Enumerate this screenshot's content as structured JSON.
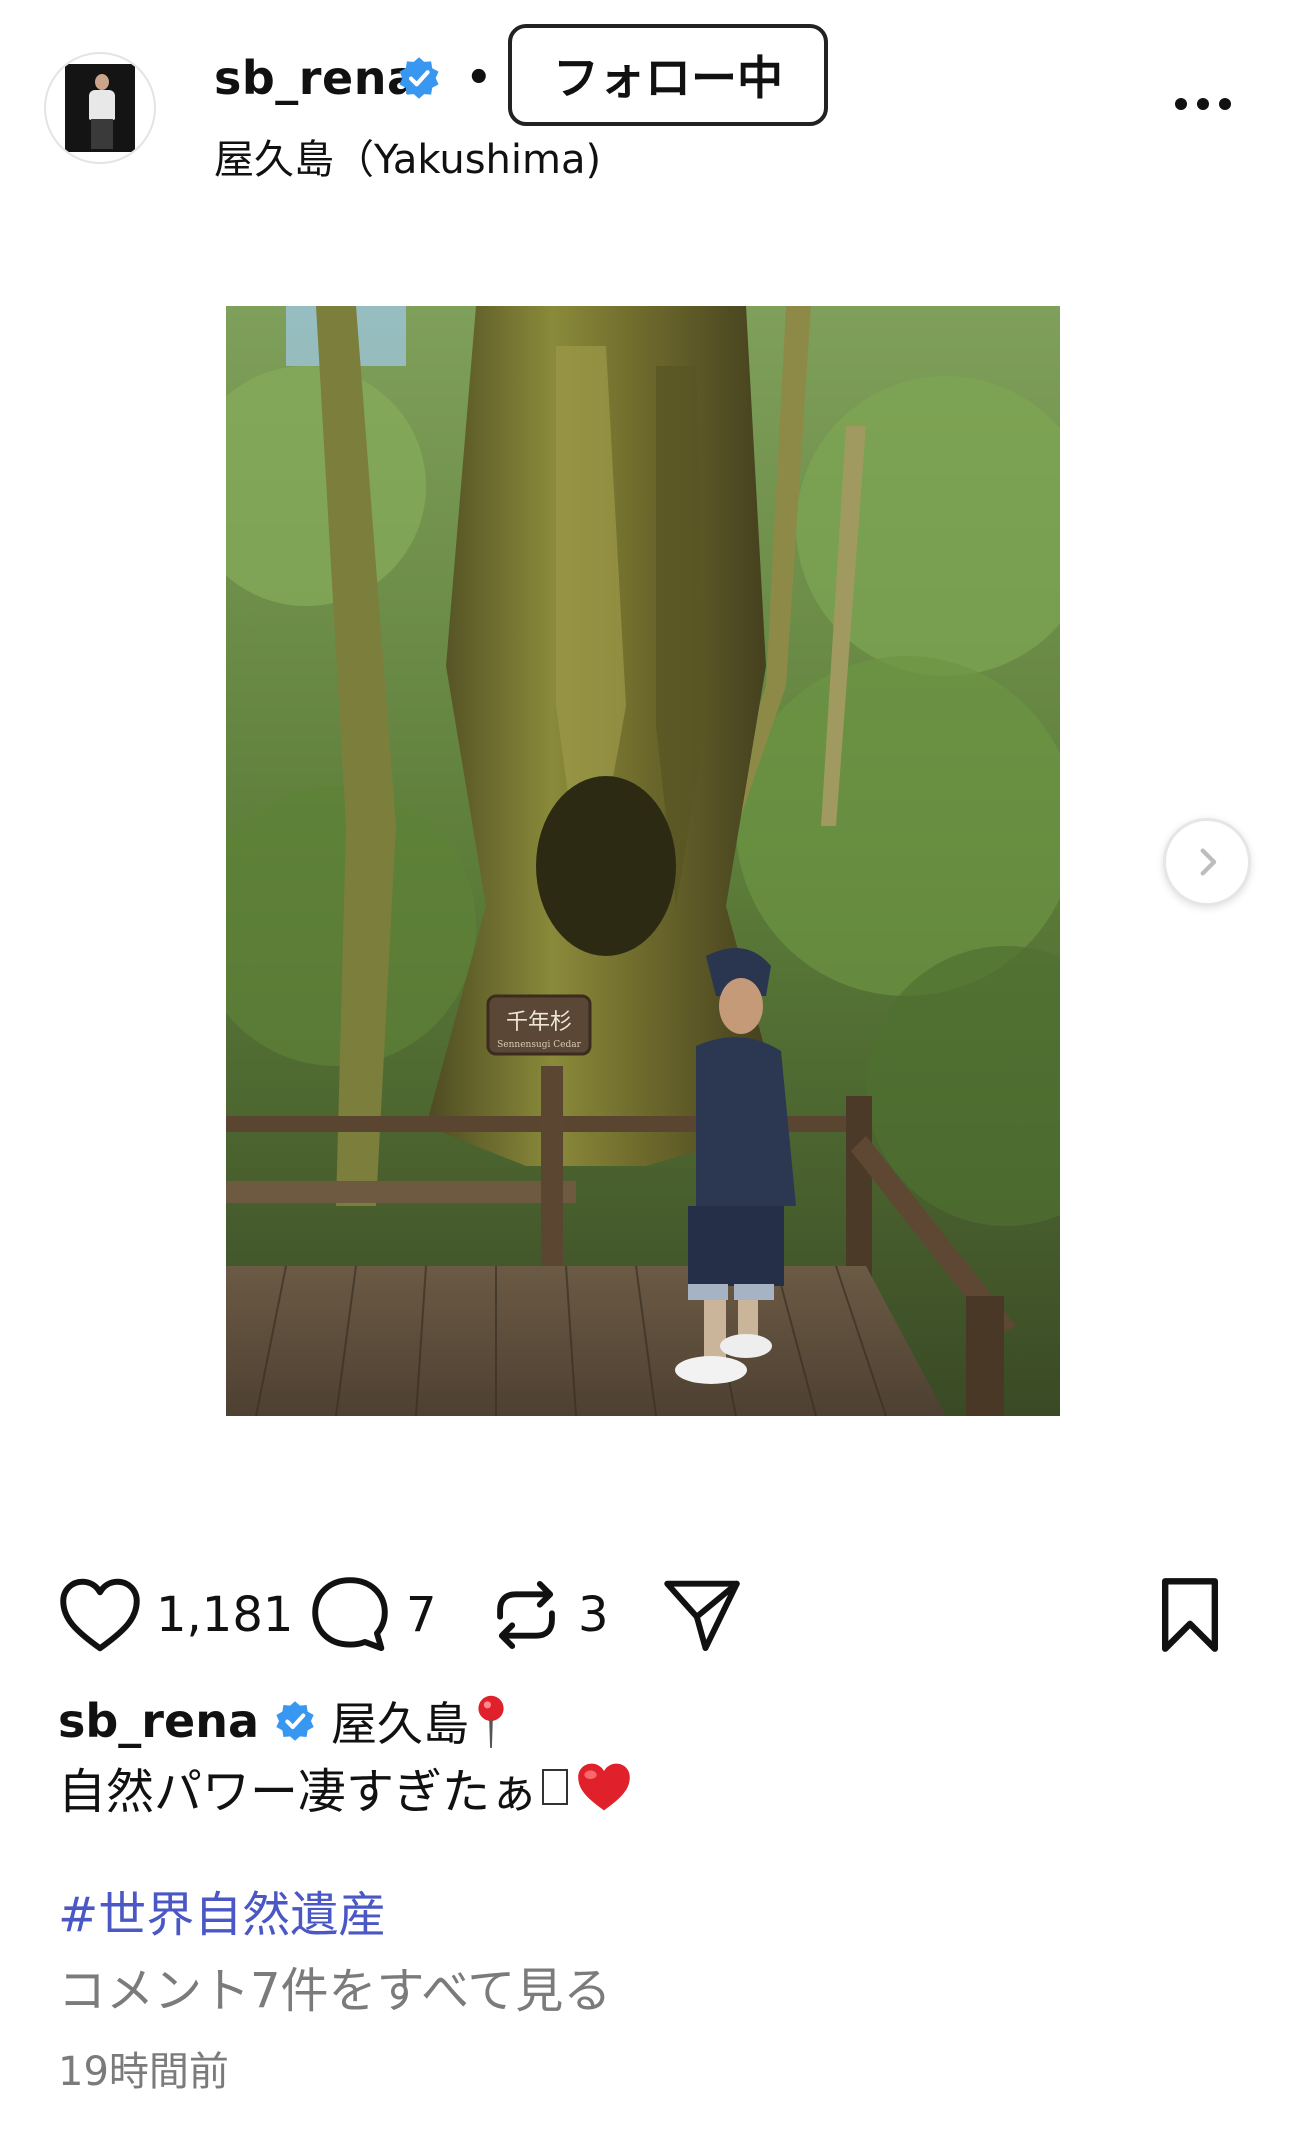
{
  "header": {
    "username": "sb_rena",
    "separator": "•",
    "follow_label": "フォロー中",
    "location": "屋久島（Yakushima)"
  },
  "post": {
    "photo_description_icon": "photo-yakushima-cedar",
    "sign_text": "千年杉",
    "sign_subtext": "Sennensugi Cedar"
  },
  "actions": {
    "likes": "1,181",
    "comments": "7",
    "reposts": "3"
  },
  "caption": {
    "username": "sb_rena",
    "line1_text": "屋久島",
    "line2_text": "自然パワー凄すぎたぁ",
    "hashtag": "#世界自然遺産",
    "view_comments": "コメント7件をすべて見る",
    "timestamp": "19時間前"
  },
  "colors": {
    "verified": "#3897f0",
    "hashtag": "#4a57c4",
    "muted": "#7b7b7b",
    "heart_red": "#e0202b"
  }
}
